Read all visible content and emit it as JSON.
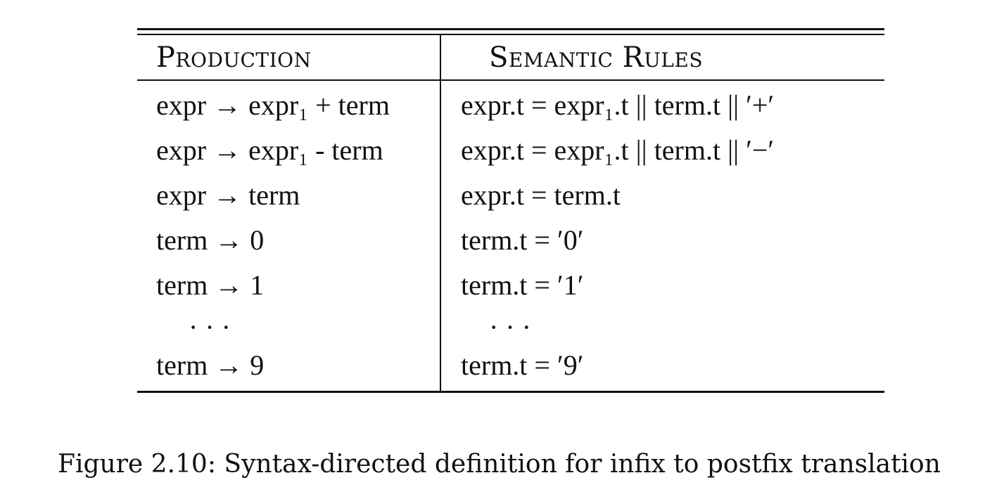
{
  "table": {
    "headers": {
      "production": "Production",
      "semantic_rules": "Semantic Rules"
    },
    "rows": [
      {
        "production": "expr → expr₁ + term",
        "semantic_rule": "expr.t  =  expr₁.t || term.t || ′+′"
      },
      {
        "production": "expr → expr₁ - term",
        "semantic_rule": "expr.t  =  expr₁.t || term.t || ′−′"
      },
      {
        "production": "expr → term",
        "semantic_rule": "expr.t  =  term.t"
      },
      {
        "production": "term → 0",
        "semantic_rule": "term.t  =  ′0′"
      },
      {
        "production": "term → 1",
        "semantic_rule": "term.t  =  ′1′"
      },
      {
        "production": "· · ·",
        "semantic_rule": "· · ·"
      },
      {
        "production": "term → 9",
        "semantic_rule": "term.t  =  ′9′"
      }
    ]
  },
  "caption": "Figure 2.10: Syntax-directed definition for infix to postfix translation"
}
